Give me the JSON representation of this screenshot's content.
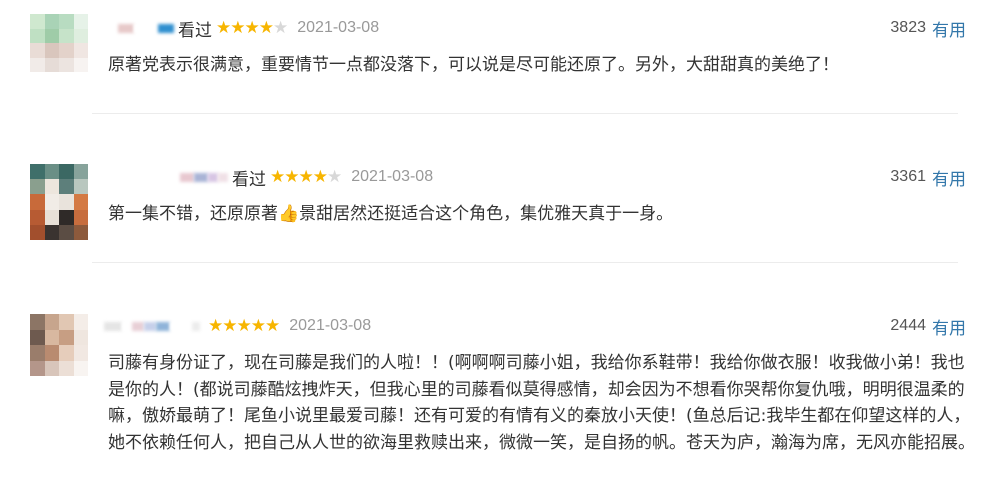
{
  "reviews": [
    {
      "status": "看过",
      "rating": 4,
      "date": "2021-03-08",
      "votes": "3823",
      "useful_label": "有用",
      "content": "原著党表示很满意，重要情节一点都没落下，可以说是尽可能还原了。另外，大甜甜真的美绝了！"
    },
    {
      "status": "看过",
      "rating": 4,
      "date": "2021-03-08",
      "votes": "3361",
      "useful_label": "有用",
      "content_before": "第一集不错，还原原著",
      "content_emoji": "👍",
      "content_after": "景甜居然还挺适合这个角色，集优雅天真于一身。"
    },
    {
      "status": "",
      "rating": 5,
      "date": "2021-03-08",
      "votes": "2444",
      "useful_label": "有用",
      "content": "司藤有身份证了，现在司藤是我们的人啦！！(啊啊啊司藤小姐，我给你系鞋带！我给你做衣服！收我做小弟！我也是你的人！(都说司藤酷炫拽炸天，但我心里的司藤看似莫得感情，却会因为不想看你哭帮你复仇哦，明明很温柔的嘛，傲娇最萌了！尾鱼小说里最爱司藤！还有可爱的有情有义的秦放小天使！(鱼总后记:我毕生都在仰望这样的人，她不依赖任何人，把自己从人世的欲海里救赎出来，微微一笑，是自扬的帆。苍天为庐，瀚海为席，无风亦能招展。"
    }
  ],
  "colors": {
    "star_on": "#f7b500",
    "star_off": "#d8d8d8",
    "link": "#3377aa",
    "meta": "#999999"
  }
}
